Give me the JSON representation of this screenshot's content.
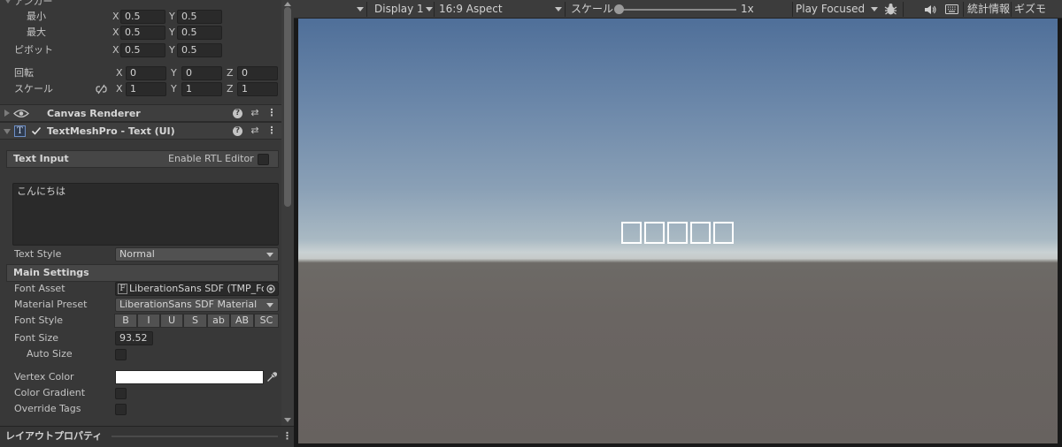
{
  "inspector": {
    "anchor_header": "アンカー",
    "anchor_min": {
      "label": "最小",
      "x_axis": "X",
      "x": "0.5",
      "y_axis": "Y",
      "y": "0.5"
    },
    "anchor_max": {
      "label": "最大",
      "x_axis": "X",
      "x": "0.5",
      "y_axis": "Y",
      "y": "0.5"
    },
    "pivot": {
      "label": "ピボット",
      "x_axis": "X",
      "x": "0.5",
      "y_axis": "Y",
      "y": "0.5"
    },
    "rotation": {
      "label": "回転",
      "x_axis": "X",
      "x": "0",
      "y_axis": "Y",
      "y": "0",
      "z_axis": "Z",
      "z": "0"
    },
    "scale": {
      "label": "スケール",
      "x_axis": "X",
      "x": "1",
      "y_axis": "Y",
      "y": "1",
      "z_axis": "Z",
      "z": "1"
    },
    "components": [
      {
        "title": "Canvas Renderer",
        "icon": "eye-icon"
      },
      {
        "title": "TextMeshPro - Text (UI)",
        "icon": "tmp-text-icon",
        "enabled": true
      }
    ],
    "help_glyph": "?",
    "preset_glyph": "⇄",
    "more_glyph": "⋮",
    "tmp_glyph": "T",
    "font_asset_glyph": "F",
    "text_input": {
      "label": "Text Input",
      "rtl_label": "Enable RTL Editor",
      "value": "こんにちは"
    },
    "text_style": {
      "label": "Text Style",
      "value": "Normal"
    },
    "main_settings": {
      "label": "Main Settings",
      "font_asset": {
        "label": "Font Asset",
        "value": "LiberationSans SDF (TMP_For"
      },
      "material_preset": {
        "label": "Material Preset",
        "value": "LiberationSans SDF Material"
      },
      "font_style": {
        "label": "Font Style",
        "buttons": [
          "B",
          "I",
          "U",
          "S",
          "ab",
          "AB",
          "SC"
        ]
      },
      "font_size": {
        "label": "Font Size",
        "value": "93.52"
      },
      "auto_size": {
        "label": "Auto Size"
      },
      "vertex_color": {
        "label": "Vertex Color",
        "color": "#ffffff"
      },
      "color_gradient": {
        "label": "Color Gradient"
      },
      "override_tags": {
        "label": "Override Tags"
      }
    },
    "layout_properties": "レイアウトプロパティ"
  },
  "game_toolbar": {
    "display": "Display 1",
    "aspect": "16:9 Aspect",
    "scale_label": "スケール",
    "scale_value": "1x",
    "scale_level": 0,
    "play_mode": "Play Focused",
    "stats": "統計情報",
    "gizmos": "ギズモ"
  },
  "game_view": {
    "sky_color": "#6b87a9",
    "ground_color": "#6a6562",
    "rendered_glyphs": 5,
    "glyph_color": "#ffffff"
  },
  "colors": {
    "panel_bg": "#383838",
    "field_bg": "#2a2a2a",
    "toolbar_bg": "#3c3c3c"
  }
}
